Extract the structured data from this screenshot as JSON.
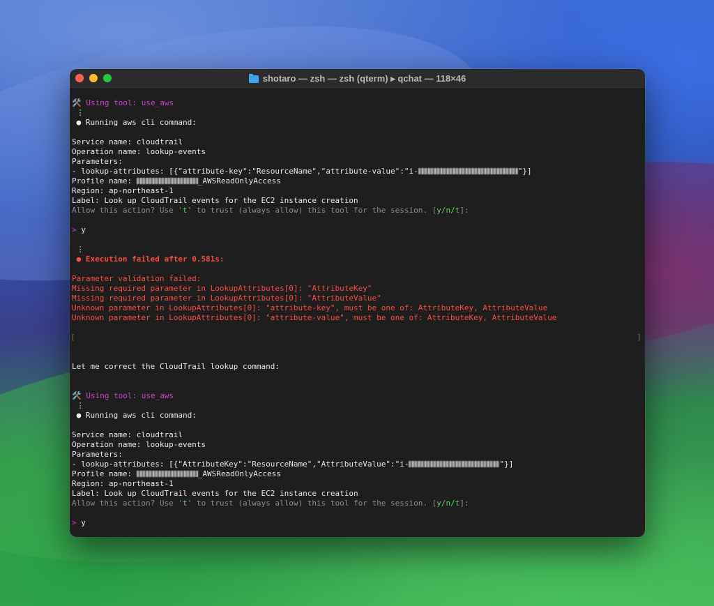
{
  "window": {
    "title": "shotaro — zsh — zsh (qterm) ▸ qchat — 118×46",
    "folder_icon": "folder-icon"
  },
  "colors": {
    "tool_magenta": "#d53fd5",
    "error_red": "#ff4a3d",
    "prompt_green": "#5bd35b",
    "hint_gray": "#8c8c8c",
    "background": "#1e1e1e"
  },
  "block1": {
    "tool_icon": "🛠️",
    "tool_line": "Using tool: use_aws",
    "vdots": "⋮",
    "running_bullet": "●",
    "running_text": "Running aws cli command:",
    "service": "Service name: cloudtrail",
    "operation": "Operation name: lookup-events",
    "parameters_label": "Parameters:",
    "param_prefix": "- lookup-attributes: [{\"attribute-key\":\"ResourceName\",\"attribute-value\":\"i-",
    "param_suffix": "\"}]",
    "profile_prefix": "Profile name: ",
    "profile_suffix": "_AWSReadOnlyAccess",
    "region": "Region: ap-northeast-1",
    "label": "Label: Look up CloudTrail events for the EC2 instance creation",
    "allow_a": "Allow this action? Use '",
    "allow_t": "t",
    "allow_b": "' to trust (always allow) this tool for the session. [",
    "allow_ynt": "y/n/t",
    "allow_c": "]:",
    "prompt_symbol": ">",
    "prompt_answer": "y"
  },
  "error": {
    "vdots": "⋮",
    "bullet": "●",
    "headline": "Execution failed after 0.581s:",
    "lines": [
      "Parameter validation failed:",
      "Missing required parameter in LookupAttributes[0]: \"AttributeKey\"",
      "Missing required parameter in LookupAttributes[0]: \"AttributeValue\"",
      "Unknown parameter in LookupAttributes[0]: \"attribute-key\", must be one of: AttributeKey, AttributeValue",
      "Unknown parameter in LookupAttributes[0]: \"attribute-value\", must be one of: AttributeKey, AttributeValue"
    ],
    "bracket_open": "[",
    "bracket_close": "]"
  },
  "correction": "Let me correct the CloudTrail lookup command:",
  "block2": {
    "tool_icon": "🛠️",
    "tool_line": "Using tool: use_aws",
    "vdots": "⋮",
    "running_bullet": "●",
    "running_text": "Running aws cli command:",
    "service": "Service name: cloudtrail",
    "operation": "Operation name: lookup-events",
    "parameters_label": "Parameters:",
    "param_prefix": "- lookup-attributes: [{\"AttributeKey\":\"ResourceName\",\"AttributeValue\":\"i-",
    "param_suffix": "\"}]",
    "profile_prefix": "Profile name: ",
    "profile_suffix": "_AWSReadOnlyAccess",
    "region": "Region: ap-northeast-1",
    "label": "Label: Look up CloudTrail events for the EC2 instance creation",
    "allow_a": "Allow this action? Use '",
    "allow_t": "t",
    "allow_b": "' to trust (always allow) this tool for the session. [",
    "allow_ynt": "y/n/t",
    "allow_c": "]:",
    "prompt_symbol": ">",
    "prompt_answer": "y"
  }
}
